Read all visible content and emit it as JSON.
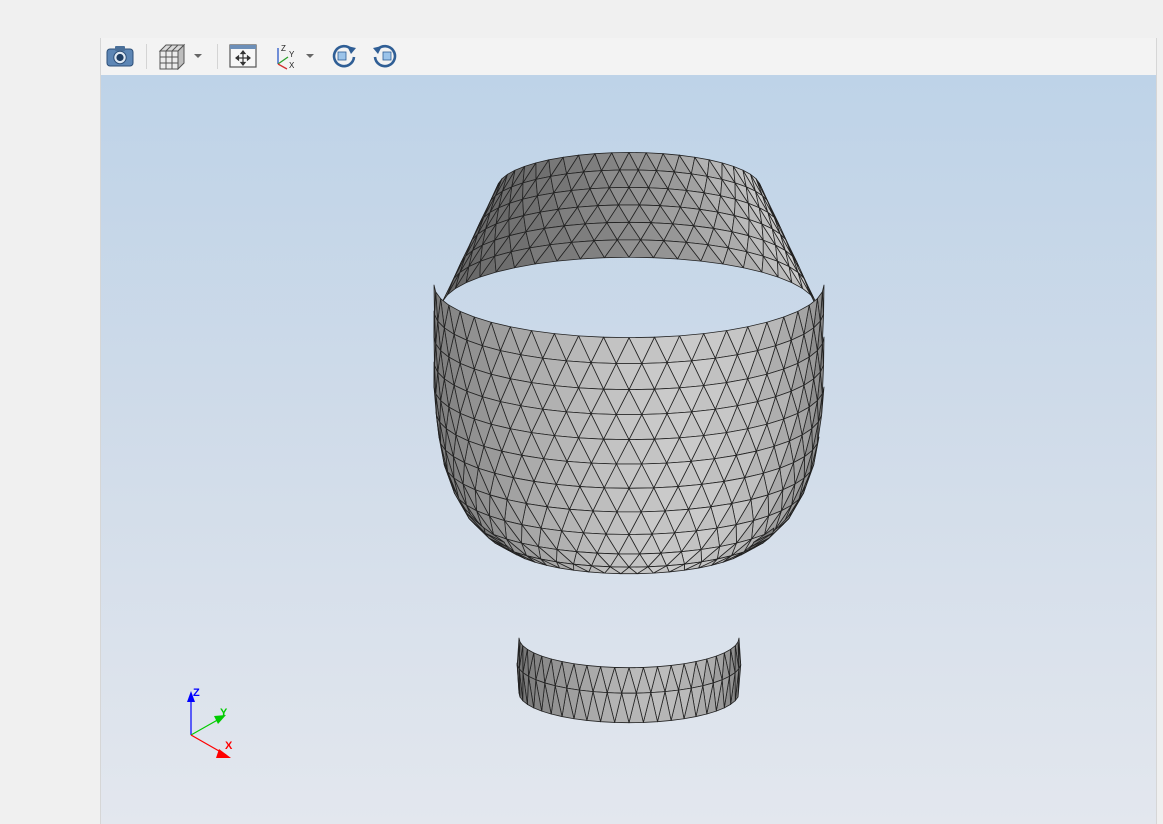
{
  "window": {
    "title": ""
  },
  "toolbar": {
    "items": [
      {
        "name": "screenshot",
        "icon": "camera-icon"
      },
      {
        "name": "display-mode",
        "icon": "cube-wireframe-icon",
        "has_dropdown": true
      },
      {
        "name": "fit-all",
        "icon": "fit-all-icon"
      },
      {
        "name": "view-orientation",
        "icon": "axes-view-icon",
        "has_dropdown": true
      },
      {
        "name": "rotate-ccw",
        "icon": "rotate-left-icon"
      },
      {
        "name": "rotate-cw",
        "icon": "rotate-right-icon"
      }
    ]
  },
  "viewport": {
    "background_top": "#bed3e8",
    "background_bottom": "#e3e7ee",
    "model": {
      "name": "cup-mesh",
      "render_mode": "shaded-with-edges",
      "color": "#c8c8c8"
    }
  },
  "triad": {
    "z_label": "Z",
    "y_label": "Y",
    "x_label": "X",
    "z_color": "#0000ff",
    "y_color": "#00cc00",
    "x_color": "#ff0000"
  },
  "icon_labels": {
    "axes_z": "Z",
    "axes_y": "Y",
    "axes_x": "X"
  }
}
